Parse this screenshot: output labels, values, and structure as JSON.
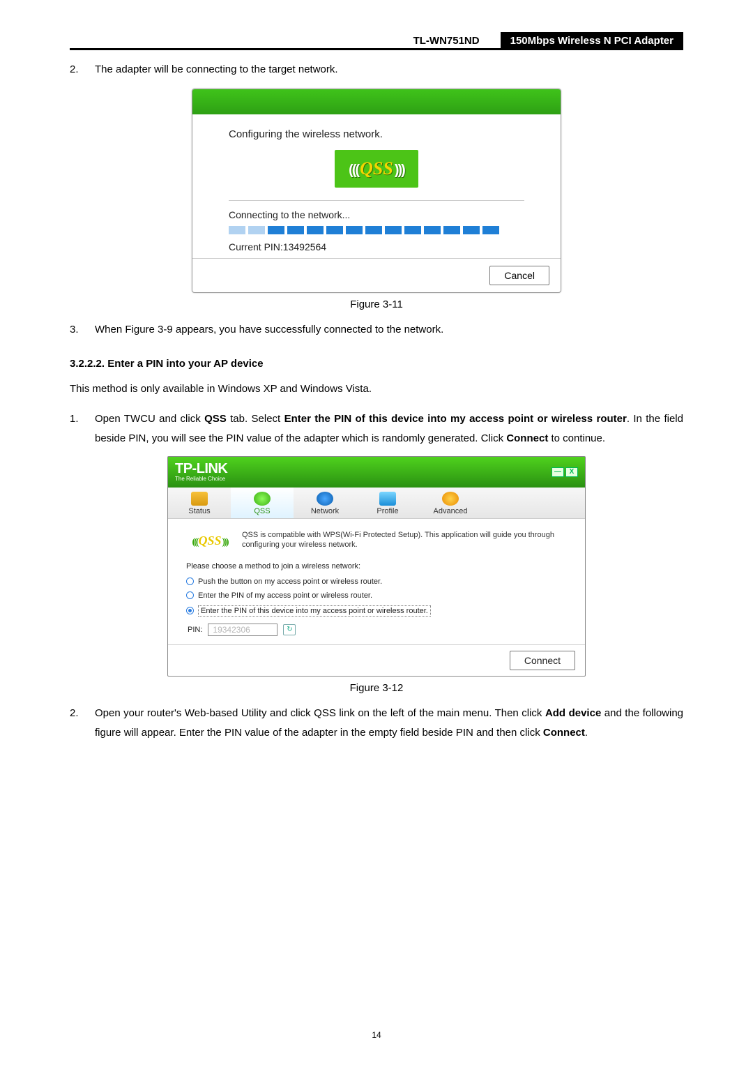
{
  "header": {
    "model": "TL-WN751ND",
    "product": "150Mbps Wireless N PCI Adapter"
  },
  "step2": {
    "num": "2.",
    "text": "The adapter will be connecting to the target network."
  },
  "fig11": {
    "heading": "Configuring the wireless network.",
    "qss": "QSS",
    "connecting": "Connecting to the network...",
    "pin_label": "Current PIN:13492564",
    "cancel": "Cancel",
    "caption": "Figure 3-11"
  },
  "step3": {
    "num": "3.",
    "text": "When Figure 3-9 appears, you have successfully connected to the network."
  },
  "section": {
    "title": "3.2.2.2.  Enter a PIN into your AP device"
  },
  "note": "This method is only available in Windows XP and Windows Vista.",
  "twcu_step1": {
    "num": "1.",
    "pre1": "Open TWCU and click ",
    "b1": "QSS",
    "mid1": " tab. Select ",
    "b2": "Enter the PIN of this device into my access point or wireless router",
    "mid2": ". In the field beside PIN, you will see the PIN value of the adapter which is randomly generated. Click ",
    "b3": "Connect",
    "post": " to continue."
  },
  "fig12": {
    "brand": "TP-LINK",
    "brand_sub": "The Reliable Choice",
    "tabs": {
      "status": "Status",
      "qss": "QSS",
      "network": "Network",
      "profile": "Profile",
      "advanced": "Advanced"
    },
    "desc": "QSS is compatible with WPS(Wi-Fi Protected Setup). This application will guide you through configuring your wireless network.",
    "choose": "Please choose a method to join a wireless network:",
    "opt1": "Push the button on my access point or wireless router.",
    "opt2": "Enter the PIN of my access point or wireless router.",
    "opt3": "Enter the PIN of this device into my access point or wireless router.",
    "pin_label": "PIN:",
    "pin_value": "19342306",
    "connect": "Connect",
    "caption": "Figure 3-12"
  },
  "twcu_step2": {
    "num": "2.",
    "pre": "Open your router's Web-based Utility and click QSS link on the left of the main menu. Then click ",
    "b1": "Add device",
    "mid": " and the following figure will appear. Enter the PIN value of the adapter in the empty field beside PIN and then click ",
    "b2": "Connect",
    "post": "."
  },
  "page_number": "14"
}
